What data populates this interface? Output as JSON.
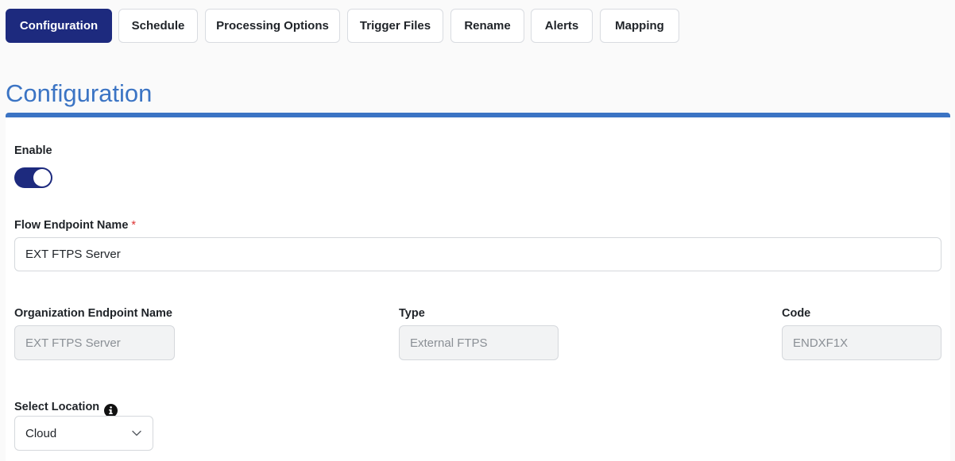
{
  "tabs": [
    {
      "label": "Configuration",
      "active": true
    },
    {
      "label": "Schedule",
      "active": false
    },
    {
      "label": "Processing Options",
      "active": false
    },
    {
      "label": "Trigger Files",
      "active": false
    },
    {
      "label": "Rename",
      "active": false
    },
    {
      "label": "Alerts",
      "active": false
    },
    {
      "label": "Mapping",
      "active": false
    }
  ],
  "section": {
    "title": "Configuration"
  },
  "form": {
    "enable": {
      "label": "Enable",
      "value": true
    },
    "flow_endpoint_name": {
      "label": "Flow Endpoint Name",
      "required_mark": "*",
      "value": "EXT FTPS Server"
    },
    "organization_endpoint_name": {
      "label": "Organization Endpoint Name",
      "value": "EXT FTPS Server"
    },
    "type": {
      "label": "Type",
      "value": "External FTPS"
    },
    "code": {
      "label": "Code",
      "value": "ENDXF1X"
    },
    "select_location": {
      "label": "Select Location",
      "value": "Cloud",
      "info_icon": "info-circle-icon"
    }
  },
  "colors": {
    "accent_navy": "#1d2a7e",
    "title_blue": "#3b74c4",
    "required_red": "#dd3333"
  }
}
